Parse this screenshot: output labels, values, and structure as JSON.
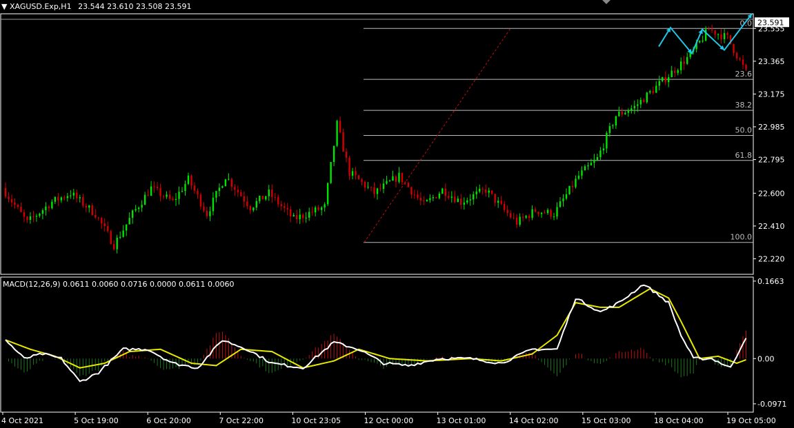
{
  "header": {
    "symbol": "XAGUSD.Exp,H1",
    "ohlc": "23.544 23.610 23.508 23.591"
  },
  "macd_header": "MACD(12,26,9) 0.0611 0.0060 0.0716 0.0000 0.0611 0.0060",
  "colors": {
    "background": "#000000",
    "grid": "#ffffff",
    "bull_candle": "#00e600",
    "bear_candle": "#d40000",
    "macd_line": "#ffffff",
    "signal_line": "#e8e800",
    "hist_pos": "#c01010",
    "hist_neg": "#1a7a1a",
    "forecast_arrow": "#1ec8e8",
    "fib_lines": "#bdbdbd"
  },
  "chart_data": [
    {
      "type": "candlestick",
      "symbol": "XAGUSD.Exp",
      "timeframe": "H1",
      "ylim": [
        22.13,
        23.64
      ],
      "y_ticks": [
        "23.555",
        "23.365",
        "23.175",
        "22.985",
        "22.795",
        "22.600",
        "22.410",
        "22.220"
      ],
      "current_price": "23.591",
      "x_labels": [
        "4 Oct 2021",
        "5 Oct 19:00",
        "6 Oct 20:00",
        "7 Oct 22:00",
        "10 Oct 23:05",
        "12 Oct 00:00",
        "13 Oct 01:00",
        "14 Oct 02:00",
        "15 Oct 03:00",
        "18 Oct 04:00",
        "19 Oct 05:00"
      ],
      "bar_count": 240,
      "close_anchors": [
        [
          0,
          22.63
        ],
        [
          8,
          22.43
        ],
        [
          16,
          22.55
        ],
        [
          22,
          22.6
        ],
        [
          30,
          22.48
        ],
        [
          36,
          22.3
        ],
        [
          42,
          22.48
        ],
        [
          48,
          22.63
        ],
        [
          55,
          22.55
        ],
        [
          60,
          22.68
        ],
        [
          66,
          22.48
        ],
        [
          72,
          22.7
        ],
        [
          80,
          22.52
        ],
        [
          86,
          22.6
        ],
        [
          94,
          22.45
        ],
        [
          104,
          22.52
        ],
        [
          108,
          23.0
        ],
        [
          112,
          22.72
        ],
        [
          120,
          22.6
        ],
        [
          128,
          22.7
        ],
        [
          136,
          22.53
        ],
        [
          142,
          22.62
        ],
        [
          148,
          22.55
        ],
        [
          156,
          22.62
        ],
        [
          162,
          22.5
        ],
        [
          166,
          22.43
        ],
        [
          172,
          22.5
        ],
        [
          178,
          22.48
        ],
        [
          186,
          22.7
        ],
        [
          192,
          22.8
        ],
        [
          198,
          23.05
        ],
        [
          204,
          23.1
        ],
        [
          210,
          23.2
        ],
        [
          216,
          23.3
        ],
        [
          222,
          23.4
        ],
        [
          228,
          23.55
        ],
        [
          234,
          23.5
        ],
        [
          240,
          23.3
        ]
      ],
      "fibonacci": [
        {
          "level": "0.0",
          "price": 23.555
        },
        {
          "level": "23.6",
          "price": 23.26
        },
        {
          "level": "38.2",
          "price": 23.08
        },
        {
          "level": "50.0",
          "price": 22.935
        },
        {
          "level": "61.8",
          "price": 22.79
        },
        {
          "level": "100.0",
          "price": 22.315
        }
      ],
      "forecast_zigzag": [
        23.45,
        23.56,
        23.41,
        23.55,
        23.43,
        23.64
      ]
    },
    {
      "type": "macd",
      "params": "12,26,9",
      "ylim": [
        -0.115,
        0.175
      ],
      "y_ticks": [
        "0.1663",
        "0.00",
        "-0.0971"
      ],
      "macd_anchors": [
        [
          0,
          0.04
        ],
        [
          6,
          0.0
        ],
        [
          12,
          0.01
        ],
        [
          18,
          0.0
        ],
        [
          24,
          -0.05
        ],
        [
          30,
          -0.03
        ],
        [
          38,
          0.02
        ],
        [
          46,
          0.02
        ],
        [
          54,
          -0.01
        ],
        [
          62,
          -0.02
        ],
        [
          70,
          0.04
        ],
        [
          78,
          0.02
        ],
        [
          86,
          -0.01
        ],
        [
          96,
          -0.02
        ],
        [
          106,
          0.035
        ],
        [
          114,
          0.02
        ],
        [
          122,
          -0.01
        ],
        [
          130,
          -0.015
        ],
        [
          140,
          0.0
        ],
        [
          150,
          0.0
        ],
        [
          160,
          -0.01
        ],
        [
          170,
          0.02
        ],
        [
          178,
          0.02
        ],
        [
          184,
          0.13
        ],
        [
          192,
          0.1
        ],
        [
          198,
          0.12
        ],
        [
          206,
          0.16
        ],
        [
          214,
          0.12
        ],
        [
          218,
          0.05
        ],
        [
          222,
          0.0
        ],
        [
          228,
          0.0
        ],
        [
          234,
          -0.02
        ],
        [
          240,
          0.06
        ]
      ],
      "signal_anchors": [
        [
          0,
          0.04
        ],
        [
          8,
          0.02
        ],
        [
          16,
          0.005
        ],
        [
          24,
          -0.02
        ],
        [
          32,
          -0.01
        ],
        [
          40,
          0.015
        ],
        [
          50,
          0.02
        ],
        [
          60,
          -0.01
        ],
        [
          68,
          -0.015
        ],
        [
          76,
          0.02
        ],
        [
          86,
          0.015
        ],
        [
          96,
          -0.02
        ],
        [
          106,
          -0.005
        ],
        [
          114,
          0.02
        ],
        [
          124,
          0.0
        ],
        [
          136,
          -0.005
        ],
        [
          150,
          0.0
        ],
        [
          160,
          -0.005
        ],
        [
          170,
          0.01
        ],
        [
          178,
          0.05
        ],
        [
          184,
          0.12
        ],
        [
          192,
          0.11
        ],
        [
          198,
          0.11
        ],
        [
          208,
          0.15
        ],
        [
          214,
          0.13
        ],
        [
          218,
          0.08
        ],
        [
          224,
          0.0
        ],
        [
          230,
          0.005
        ],
        [
          236,
          -0.01
        ],
        [
          240,
          0.0
        ]
      ]
    }
  ]
}
